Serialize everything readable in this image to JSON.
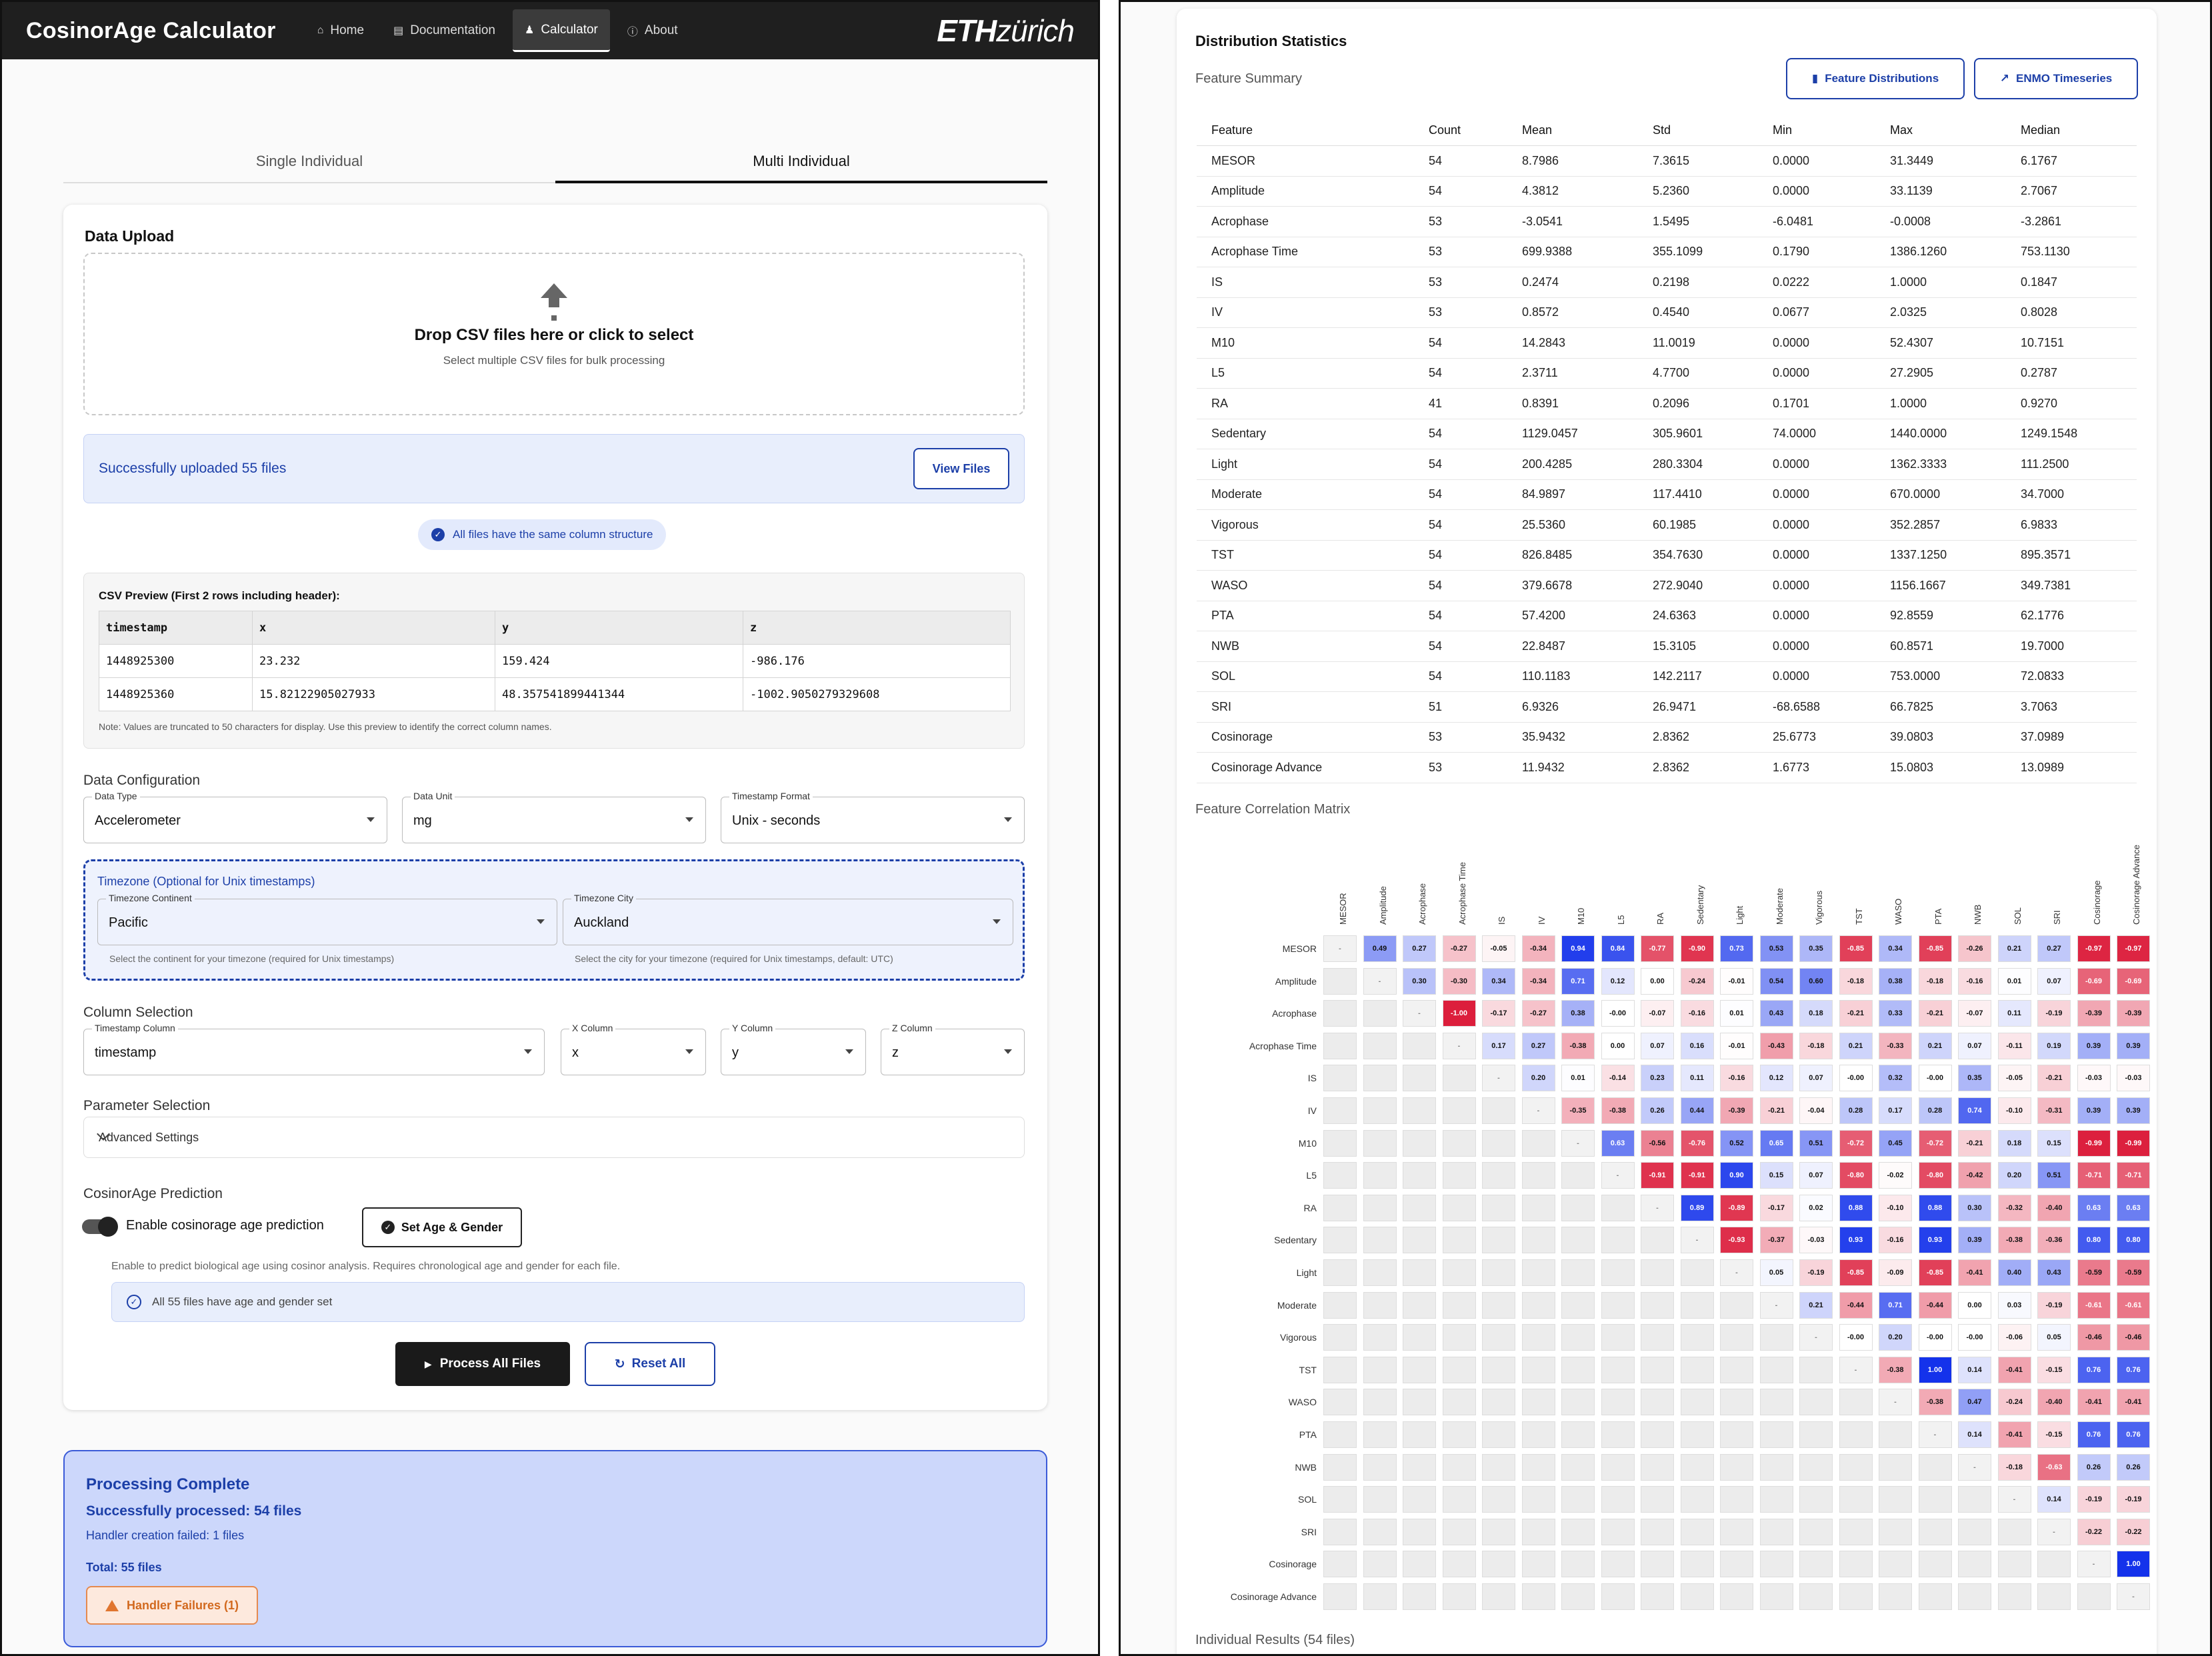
{
  "navbar": {
    "brand": "CosinorAge Calculator",
    "links": [
      {
        "label": "Home",
        "icon": "home-icon"
      },
      {
        "label": "Documentation",
        "icon": "book-icon"
      },
      {
        "label": "Calculator",
        "icon": "person-icon"
      },
      {
        "label": "About",
        "icon": "info-icon"
      }
    ],
    "logo_a": "ETH",
    "logo_b": "zürich"
  },
  "tabs": [
    "Single Individual",
    "Multi Individual"
  ],
  "upload": {
    "title": "Data Upload",
    "drop_title": "Drop CSV files here or click to select",
    "drop_sub": "Select multiple CSV files for bulk processing",
    "success": "Successfully uploaded 55 files",
    "view_files": "View Files",
    "same_structure": "All files have the same column structure"
  },
  "preview": {
    "title": "CSV Preview (First 2 rows including header):",
    "rows": [
      [
        "timestamp",
        "x",
        "y",
        "z"
      ],
      [
        "1448925300",
        "23.232",
        "159.424",
        "-986.176"
      ],
      [
        "1448925360",
        "15.82122905027933",
        "48.357541899441344",
        "-1002.9050279329608"
      ]
    ],
    "note": "Note: Values are truncated to 50 characters for display. Use this preview to identify the correct column names."
  },
  "config": {
    "title": "Data Configuration",
    "data_type_label": "Data Type",
    "data_type": "Accelerometer",
    "data_unit_label": "Data Unit",
    "data_unit": "mg",
    "ts_format_label": "Timestamp Format",
    "ts_format": "Unix - seconds"
  },
  "timezone": {
    "title": "Timezone (Optional for Unix timestamps)",
    "continent_label": "Timezone Continent",
    "continent": "Pacific",
    "continent_help": "Select the continent for your timezone (required for Unix timestamps)",
    "city_label": "Timezone City",
    "city": "Auckland",
    "city_help": "Select the city for your timezone (required for Unix timestamps, default: UTC)"
  },
  "columns": {
    "title": "Column Selection",
    "ts_label": "Timestamp Column",
    "ts": "timestamp",
    "x_label": "X Column",
    "x": "x",
    "y_label": "Y Column",
    "y": "y",
    "z_label": "Z Column",
    "z": "z"
  },
  "params": {
    "title": "Parameter Selection",
    "advanced": "Advanced Settings"
  },
  "prediction": {
    "title": "CosinorAge Prediction",
    "toggle_label": "Enable cosinorage age prediction",
    "set_btn": "Set Age & Gender",
    "help": "Enable to predict biological age using cosinor analysis. Requires chronological age and gender for each file.",
    "all_set": "All 55 files have age and gender set"
  },
  "actions": {
    "process": "Process All Files",
    "reset": "Reset All"
  },
  "complete": {
    "title": "Processing Complete",
    "success": "Successfully processed: 54 files",
    "failed": "Handler creation failed: 1 files",
    "total": "Total: 55 files",
    "failures_btn": "Handler Failures (1)"
  },
  "dist": {
    "title": "Distribution Statistics",
    "summary": "Feature Summary",
    "btn_feat": "Feature Distributions",
    "btn_enmo": "ENMO Timeseries",
    "headers": [
      "Feature",
      "Count",
      "Mean",
      "Std",
      "Min",
      "Max",
      "Median"
    ],
    "rows": [
      [
        "MESOR",
        "54",
        "8.7986",
        "7.3615",
        "0.0000",
        "31.3449",
        "6.1767"
      ],
      [
        "Amplitude",
        "54",
        "4.3812",
        "5.2360",
        "0.0000",
        "33.1139",
        "2.7067"
      ],
      [
        "Acrophase",
        "53",
        "-3.0541",
        "1.5495",
        "-6.0481",
        "-0.0008",
        "-3.2861"
      ],
      [
        "Acrophase Time",
        "53",
        "699.9388",
        "355.1099",
        "0.1790",
        "1386.1260",
        "753.1130"
      ],
      [
        "IS",
        "53",
        "0.2474",
        "0.2198",
        "0.0222",
        "1.0000",
        "0.1847"
      ],
      [
        "IV",
        "53",
        "0.8572",
        "0.4540",
        "0.0677",
        "2.0325",
        "0.8028"
      ],
      [
        "M10",
        "54",
        "14.2843",
        "11.0019",
        "0.0000",
        "52.4307",
        "10.7151"
      ],
      [
        "L5",
        "54",
        "2.3711",
        "4.7700",
        "0.0000",
        "27.2905",
        "0.2787"
      ],
      [
        "RA",
        "41",
        "0.8391",
        "0.2096",
        "0.1701",
        "1.0000",
        "0.9270"
      ],
      [
        "Sedentary",
        "54",
        "1129.0457",
        "305.9601",
        "74.0000",
        "1440.0000",
        "1249.1548"
      ],
      [
        "Light",
        "54",
        "200.4285",
        "280.3304",
        "0.0000",
        "1362.3333",
        "111.2500"
      ],
      [
        "Moderate",
        "54",
        "84.9897",
        "117.4410",
        "0.0000",
        "670.0000",
        "34.7000"
      ],
      [
        "Vigorous",
        "54",
        "25.5360",
        "60.1985",
        "0.0000",
        "352.2857",
        "6.9833"
      ],
      [
        "TST",
        "54",
        "826.8485",
        "354.7630",
        "0.0000",
        "1337.1250",
        "895.3571"
      ],
      [
        "WASO",
        "54",
        "379.6678",
        "272.9040",
        "0.0000",
        "1156.1667",
        "349.7381"
      ],
      [
        "PTA",
        "54",
        "57.4200",
        "24.6363",
        "0.0000",
        "92.8559",
        "62.1776"
      ],
      [
        "NWB",
        "54",
        "22.8487",
        "15.3105",
        "0.0000",
        "60.8571",
        "19.7000"
      ],
      [
        "SOL",
        "54",
        "110.1183",
        "142.2117",
        "0.0000",
        "753.0000",
        "72.0833"
      ],
      [
        "SRI",
        "51",
        "6.9326",
        "26.9471",
        "-68.6588",
        "66.7825",
        "3.7063"
      ],
      [
        "Cosinorage",
        "53",
        "35.9432",
        "2.8362",
        "25.6773",
        "39.0803",
        "37.0989"
      ],
      [
        "Cosinorage Advance",
        "53",
        "11.9432",
        "2.8362",
        "1.6773",
        "15.0803",
        "13.0989"
      ]
    ],
    "corr_title": "Feature Correlation Matrix",
    "individual": "Individual Results (54 files)"
  },
  "chart_data": {
    "type": "heatmap",
    "title": "Feature Correlation Matrix",
    "labels": [
      "MESOR",
      "Amplitude",
      "Acrophase",
      "Acrophase Time",
      "IS",
      "IV",
      "M10",
      "L5",
      "RA",
      "Sedentary",
      "Light",
      "Moderate",
      "Vigorous",
      "TST",
      "WASO",
      "PTA",
      "NWB",
      "SOL",
      "SRI",
      "Cosinorage",
      "Cosinorage Advance"
    ],
    "upper": [
      [
        "0.49",
        "0.27",
        "-0.27",
        "-0.05",
        "-0.34",
        "0.94",
        "0.84",
        "-0.77",
        "-0.90",
        "0.73",
        "0.53",
        "0.35",
        "-0.85",
        "0.34",
        "-0.85",
        "-0.26",
        "0.21",
        "0.27",
        "-0.97",
        "-0.97"
      ],
      [
        "0.30",
        "-0.30",
        "0.34",
        "-0.34",
        "0.71",
        "0.12",
        "0.00",
        "-0.24",
        "-0.01",
        "0.54",
        "0.60",
        "-0.18",
        "0.38",
        "-0.18",
        "-0.16",
        "0.01",
        "0.07",
        "-0.69",
        "-0.69"
      ],
      [
        "-1.00",
        "-0.17",
        "-0.27",
        "0.38",
        "-0.00",
        "-0.07",
        "-0.16",
        "0.01",
        "0.43",
        "0.18",
        "-0.21",
        "0.33",
        "-0.21",
        "-0.07",
        "0.11",
        "-0.19",
        "-0.39",
        "-0.39"
      ],
      [
        "0.17",
        "0.27",
        "-0.38",
        "0.00",
        "0.07",
        "0.16",
        "-0.01",
        "-0.43",
        "-0.18",
        "0.21",
        "-0.33",
        "0.21",
        "0.07",
        "-0.11",
        "0.19",
        "0.39",
        "0.39"
      ],
      [
        "0.20",
        "0.01",
        "-0.14",
        "0.23",
        "0.11",
        "-0.16",
        "0.12",
        "0.07",
        "-0.00",
        "0.32",
        "-0.00",
        "0.35",
        "-0.05",
        "-0.21",
        "-0.03",
        "-0.03"
      ],
      [
        "-0.35",
        "-0.38",
        "0.26",
        "0.44",
        "-0.39",
        "-0.21",
        "-0.04",
        "0.28",
        "0.17",
        "0.28",
        "0.74",
        "-0.10",
        "-0.31",
        "0.39",
        "0.39"
      ],
      [
        "0.63",
        "-0.56",
        "-0.76",
        "0.52",
        "0.65",
        "0.51",
        "-0.72",
        "0.45",
        "-0.72",
        "-0.21",
        "0.18",
        "0.15",
        "-0.99",
        "-0.99"
      ],
      [
        "-0.91",
        "-0.91",
        "0.90",
        "0.15",
        "0.07",
        "-0.80",
        "-0.02",
        "-0.80",
        "-0.42",
        "0.20",
        "0.51",
        "-0.71",
        "-0.71"
      ],
      [
        "0.89",
        "-0.89",
        "-0.17",
        "0.02",
        "0.88",
        "-0.10",
        "0.88",
        "0.30",
        "-0.32",
        "-0.40",
        "0.63",
        "0.63"
      ],
      [
        "-0.93",
        "-0.37",
        "-0.03",
        "0.93",
        "-0.16",
        "0.93",
        "0.39",
        "-0.38",
        "-0.36",
        "0.80",
        "0.80"
      ],
      [
        "0.05",
        "-0.19",
        "-0.85",
        "-0.09",
        "-0.85",
        "-0.41",
        "0.40",
        "0.43",
        "-0.59",
        "-0.59"
      ],
      [
        "0.21",
        "-0.44",
        "0.71",
        "-0.44",
        "0.00",
        "0.03",
        "-0.19",
        "-0.61",
        "-0.61"
      ],
      [
        "-0.00",
        "0.20",
        "-0.00",
        "-0.00",
        "-0.06",
        "0.05",
        "-0.46",
        "-0.46"
      ],
      [
        "-0.38",
        "1.00",
        "0.14",
        "-0.41",
        "-0.15",
        "0.76",
        "0.76"
      ],
      [
        "-0.38",
        "0.47",
        "-0.24",
        "-0.40",
        "-0.41",
        "-0.41"
      ],
      [
        "0.14",
        "-0.41",
        "-0.15",
        "0.76",
        "0.76"
      ],
      [
        "-0.18",
        "-0.63",
        "0.26",
        "0.26"
      ],
      [
        "0.14",
        "-0.19",
        "-0.19"
      ],
      [
        "-0.22",
        "-0.22"
      ],
      [
        "1.00"
      ],
      []
    ],
    "diagonal_label": "-"
  }
}
